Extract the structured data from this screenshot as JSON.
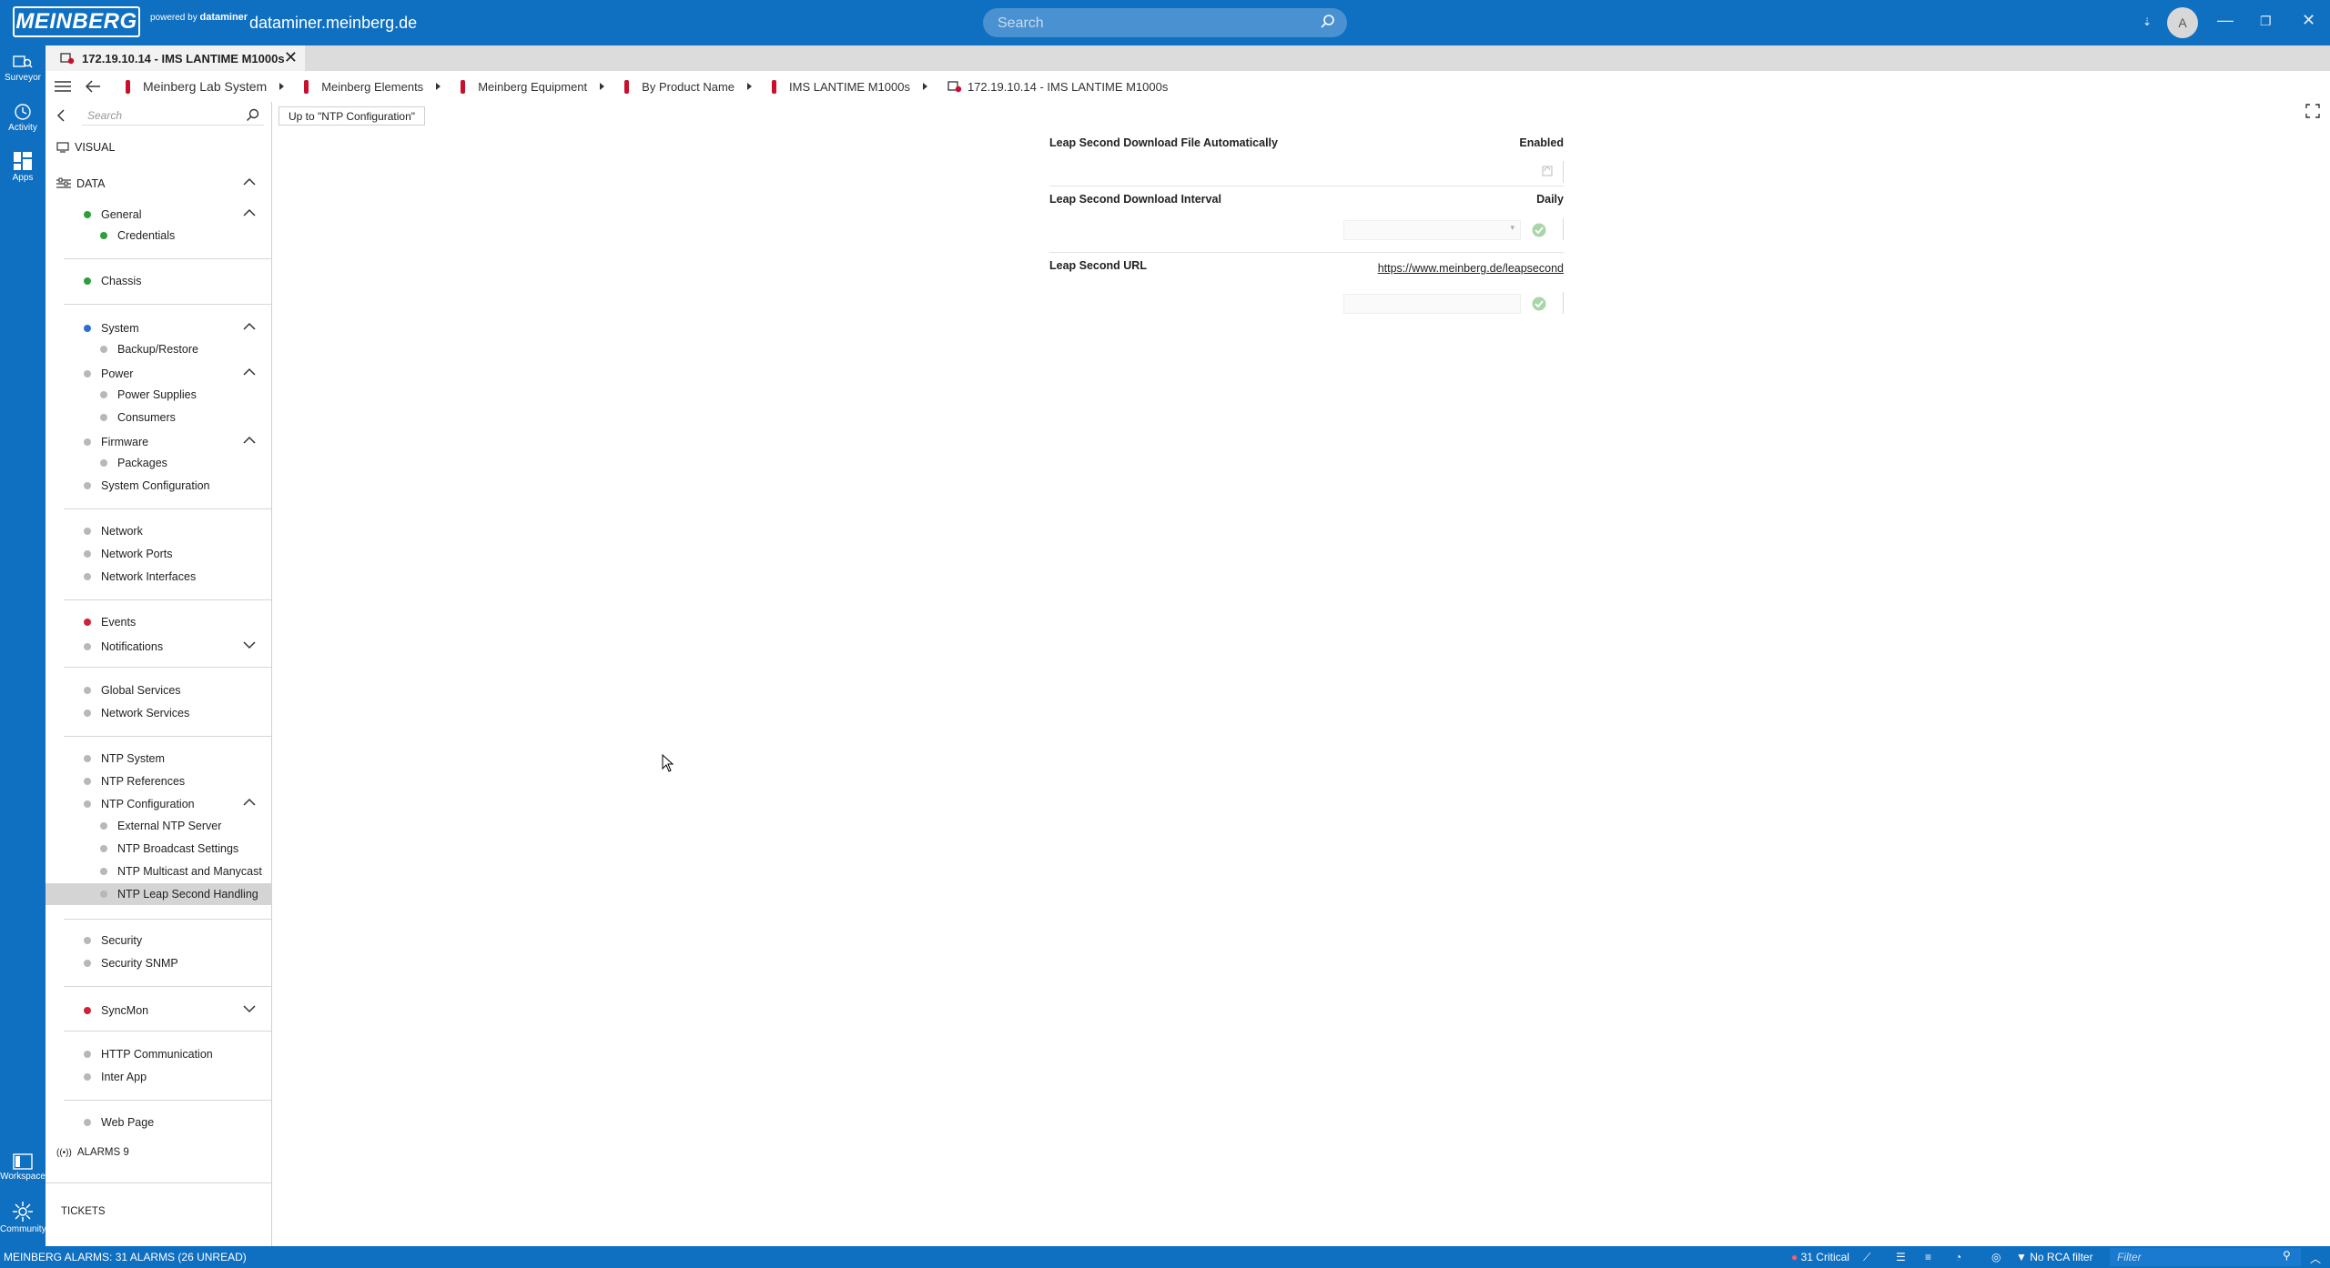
{
  "app": {
    "logo_text": "MEINBERG",
    "powered_by": "powered by",
    "powered_brand": "dataminer",
    "hostname": "dataminer.meinberg.de",
    "search_placeholder": "Search",
    "avatar_initial": "A"
  },
  "rail": {
    "surveyor": "Surveyor",
    "activity": "Activity",
    "apps": "Apps",
    "workspace": "Workspace",
    "community": "Community"
  },
  "tab": {
    "title": "172.19.10.14 - IMS LANTIME M1000s"
  },
  "breadcrumb": [
    "Meinberg Lab System",
    "Meinberg Elements",
    "Meinberg Equipment",
    "By Product Name",
    "IMS LANTIME M1000s",
    "172.19.10.14 - IMS LANTIME M1000s"
  ],
  "tree": {
    "search_placeholder": "Search",
    "visual": "VISUAL",
    "data": "DATA",
    "items": {
      "general": "General",
      "credentials": "Credentials",
      "chassis": "Chassis",
      "system": "System",
      "backup": "Backup/Restore",
      "power": "Power",
      "power_supplies": "Power Supplies",
      "consumers": "Consumers",
      "firmware": "Firmware",
      "packages": "Packages",
      "system_config": "System Configuration",
      "network": "Network",
      "network_ports": "Network Ports",
      "network_interfaces": "Network Interfaces",
      "events": "Events",
      "notifications": "Notifications",
      "global_services": "Global Services",
      "network_services": "Network Services",
      "ntp_system": "NTP System",
      "ntp_references": "NTP References",
      "ntp_configuration": "NTP Configuration",
      "external_ntp": "External NTP Server",
      "ntp_broadcast": "NTP Broadcast Settings",
      "ntp_multicast": "NTP Multicast and Manycast",
      "ntp_leap": "NTP Leap Second Handling",
      "security": "Security",
      "security_snmp": "Security SNMP",
      "syncmon": "SyncMon",
      "http_comm": "HTTP Communication",
      "inter_app": "Inter App",
      "web_page": "Web Page"
    },
    "alarms": "ALARMS 9",
    "tickets": "TICKETS"
  },
  "content": {
    "up_button": "Up to \"NTP Configuration\"",
    "params": [
      {
        "label": "Leap Second Download File Automatically",
        "value": "Enabled"
      },
      {
        "label": "Leap Second Download Interval",
        "value": "Daily"
      },
      {
        "label": "Leap Second URL",
        "value": "https://www.meinberg.de/leapsecond"
      }
    ]
  },
  "statusbar": {
    "alarms_text": "MEINBERG ALARMS: 31 ALARMS (26 UNREAD)",
    "critical": "31 Critical",
    "rca": "No RCA filter",
    "filter_placeholder": "Filter"
  },
  "colors": {
    "brand_blue": "#0f6fc0",
    "status_green": "#2e9e3b",
    "status_red": "#d0213b",
    "status_blue": "#2b6fd6",
    "status_gray": "#b8b8b8"
  }
}
